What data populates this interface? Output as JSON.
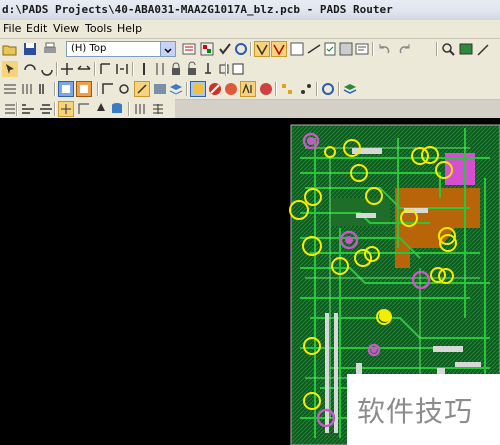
{
  "window": {
    "title": "d:\\PADS Projects\\40-ABA031-MAA2G1017A_blz.pcb - PADS Router"
  },
  "menu": {
    "items": [
      "File",
      "Edit",
      "View",
      "Tools",
      "Help"
    ]
  },
  "toolbar": {
    "layer_select_value": "(H) Top"
  },
  "watermark": {
    "text": "软件技巧"
  },
  "colors": {
    "board": "#0f6e24",
    "trace": "#23c23a",
    "copper": "#c26e0a",
    "highlight_circle": "#f5ec00",
    "error_circle": "#c25cc0",
    "pad": "#e6e6e6"
  }
}
